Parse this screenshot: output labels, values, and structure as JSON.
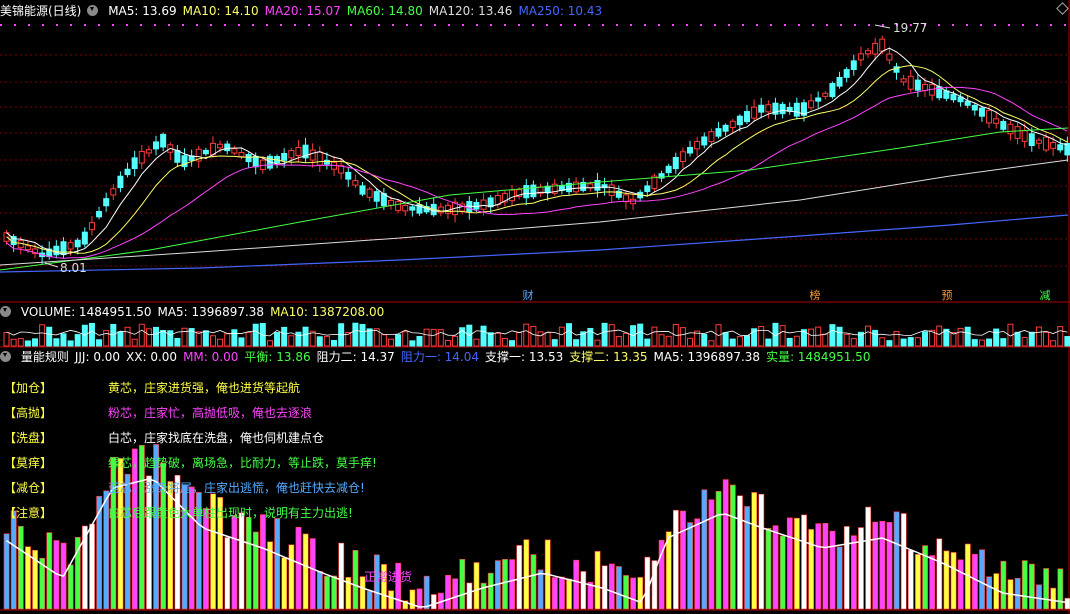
{
  "price_header": {
    "title": "美锦能源(日线)",
    "items": [
      {
        "label": "MA5: 13.69",
        "color": "#ffffff"
      },
      {
        "label": "MA10: 14.10",
        "color": "#ffff66"
      },
      {
        "label": "MA20: 15.07",
        "color": "#ff44ff"
      },
      {
        "label": "MA60: 14.80",
        "color": "#44ff44"
      },
      {
        "label": "MA120: 13.46",
        "color": "#dddddd"
      },
      {
        "label": "MA250: 10.43",
        "color": "#4466ff"
      }
    ]
  },
  "price_annotations": {
    "high": "19.77",
    "low": "8.01"
  },
  "markers": [
    {
      "label": "财",
      "color": "#55aaff"
    },
    {
      "label": "榜",
      "color": "#ff9933"
    },
    {
      "label": "预",
      "color": "#ff9933"
    },
    {
      "label": "减",
      "color": "#44ff44"
    }
  ],
  "volume_header": {
    "items": [
      {
        "label": "VOLUME: 1484951.50",
        "color": "#ffffff"
      },
      {
        "label": "MA5: 1396897.38",
        "color": "#ffffff"
      },
      {
        "label": "MA10: 1387208.00",
        "color": "#ffff66"
      }
    ]
  },
  "indicator_header": {
    "items": [
      {
        "label": "量能规则",
        "color": "#ffffff"
      },
      {
        "label": "JJJ: 0.00",
        "color": "#ffffff"
      },
      {
        "label": "XX: 0.00",
        "color": "#ffffff"
      },
      {
        "label": "MM: 0.00",
        "color": "#ff44ff"
      },
      {
        "label": "平衡: 13.86",
        "color": "#44ff44"
      },
      {
        "label": "阻力二: 14.37",
        "color": "#ffffff"
      },
      {
        "label": "阻力一: 14.04",
        "color": "#4466ff"
      },
      {
        "label": "支撑一: 13.53",
        "color": "#ffffff"
      },
      {
        "label": "支撑二: 13.35",
        "color": "#ffff66"
      },
      {
        "label": "MA5: 1396897.38",
        "color": "#ffffff"
      },
      {
        "label": "实量: 1484951.50",
        "color": "#44ff44"
      }
    ]
  },
  "explanations": [
    {
      "tag": "【加仓】",
      "text": "黄芯，庄家进货强，俺也进货等起航",
      "tag_color": "#ffff44",
      "color": "#ffff44"
    },
    {
      "tag": "【高抛】",
      "text": "粉芯，庄家忙，高抛低吸，俺也去逐浪",
      "tag_color": "#ffff44",
      "color": "#ff44ff"
    },
    {
      "tag": "【洗盘】",
      "text": "白芯，庄家找底在洗盘，俺也伺机建点仓",
      "tag_color": "#ffff44",
      "color": "#ffffff"
    },
    {
      "tag": "【莫痒】",
      "text": "绿芯，趋势破，离场急，比耐力，等止跌，莫手痒!",
      "tag_color": "#ffff44",
      "color": "#44ff44"
    },
    {
      "tag": "【减仓】",
      "text": "蓝芯，涨势将尾，庄家出逃慌，俺也赶快去减仓!",
      "tag_color": "#ffff44",
      "color": "#55aaff"
    },
    {
      "tag": "【注意】",
      "text": "白芯后跟黄色大单柱出现时，说明有主力出逃!",
      "tag_color": "#ffff44",
      "color": "#44ff44"
    }
  ],
  "bottom_label": {
    "text": "正常进货",
    "color": "#ff44ff"
  },
  "colors": {
    "up": "#ff3b3b",
    "down": "#54ffff",
    "grid": "#7a0000"
  }
}
